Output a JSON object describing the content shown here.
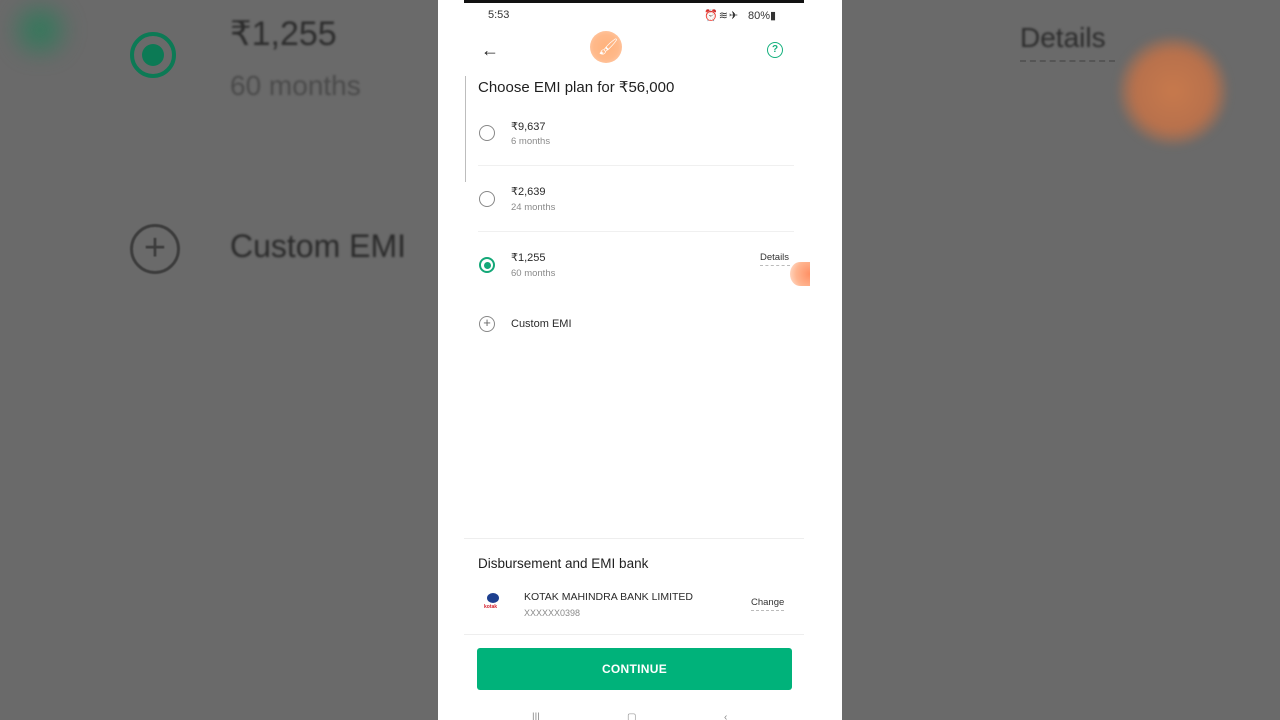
{
  "background": {
    "amount": "₹1,255",
    "months": "60 months",
    "custom": "Custom EMI",
    "details": "Details"
  },
  "status_bar": {
    "time": "5:53",
    "battery": "80%"
  },
  "header": {
    "title": "Choose EMI plan for ₹56,000"
  },
  "plans": [
    {
      "amount": "₹9,637",
      "months": "6 months",
      "selected": false
    },
    {
      "amount": "₹2,639",
      "months": "24 months",
      "selected": false
    },
    {
      "amount": "₹1,255",
      "months": "60 months",
      "selected": true
    }
  ],
  "details_label": "Details",
  "custom_emi_label": "Custom EMI",
  "bank": {
    "section_title": "Disbursement and EMI bank",
    "logo_text": "kotak",
    "name": "KOTAK MAHINDRA BANK LIMITED",
    "account": "XXXXXX0398",
    "change_label": "Change"
  },
  "continue_label": "CONTINUE",
  "colors": {
    "accent": "#00b27a",
    "selected_radio": "#14a878"
  }
}
